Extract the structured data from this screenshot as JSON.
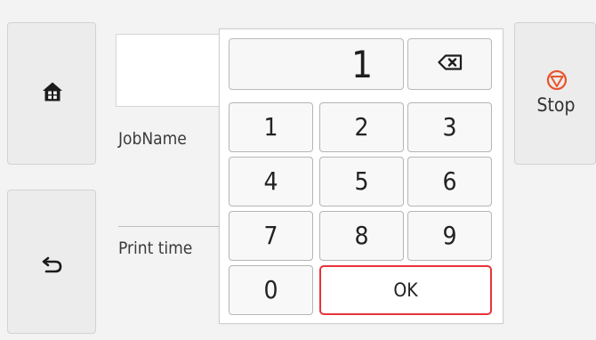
{
  "background": {
    "job_name_label": "JobName",
    "print_time_label": "Print time"
  },
  "stop_button": {
    "label": "Stop"
  },
  "keypad": {
    "display_value": "1",
    "keys": [
      "1",
      "2",
      "3",
      "4",
      "5",
      "6",
      "7",
      "8",
      "9",
      "0"
    ],
    "ok_label": "OK"
  },
  "colors": {
    "stop_accent": "#e8552c",
    "ok_border": "#e8333b"
  },
  "icons": {
    "home": "home-icon",
    "back": "back-icon",
    "stop": "stop-icon",
    "backspace": "backspace-icon"
  }
}
